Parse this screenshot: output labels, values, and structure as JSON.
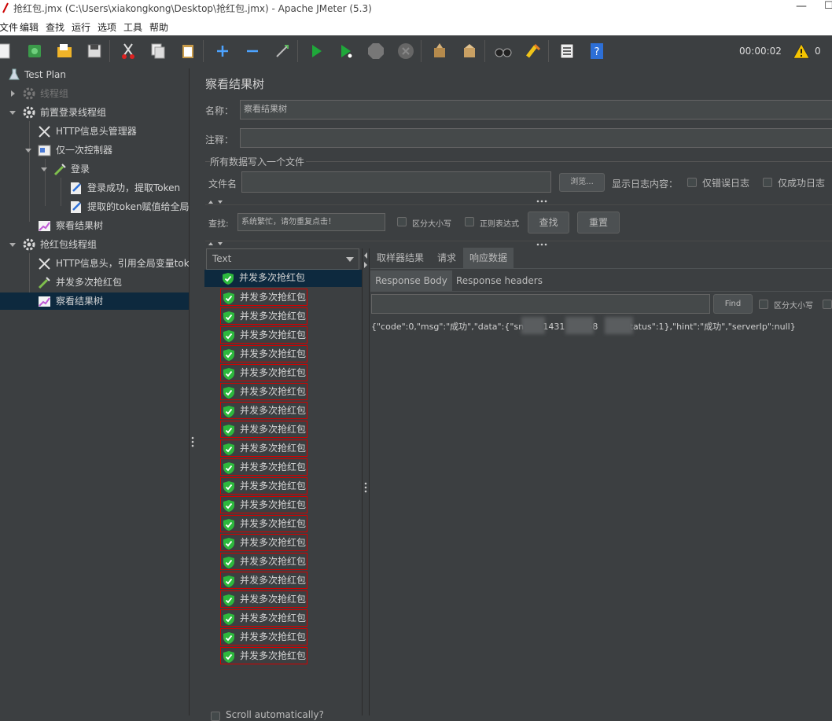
{
  "window": {
    "title": "抢红包.jmx (C:\\Users\\xiakongkong\\Desktop\\抢红包.jmx) - Apache JMeter (5.3)",
    "minimize": "—",
    "maximize": "☐"
  },
  "menu": [
    "文件",
    "编辑",
    "查找",
    "运行",
    "选项",
    "工具",
    "帮助"
  ],
  "toolbar": {
    "icons": [
      "new-icon",
      "templates-icon",
      "open-icon",
      "save-icon",
      "cut-icon",
      "copy-icon",
      "paste-icon",
      "expand-icon",
      "collapse-icon",
      "toggle-icon",
      "start-icon",
      "start-no-pause-icon",
      "stop-icon",
      "shutdown-icon",
      "clear-icon",
      "clear-all-icon",
      "search-icon",
      "reset-search-icon",
      "function-helper-icon",
      "help-icon"
    ],
    "timer": "00:00:02",
    "warning_count": "0"
  },
  "tree": {
    "test_plan": "Test Plan",
    "thread_group": "线程组",
    "login_group": "前置登录线程组",
    "http_header_manager": "HTTP信息头管理器",
    "once_controller": "仅一次控制器",
    "login": "登录",
    "extract_token": "登录成功，提取Token",
    "token_global": "提取的token赋值给全局变",
    "view_results_1": "察看结果树",
    "grab_group": "抢红包线程组",
    "http_header_global": "HTTP信息头，引用全局变量token",
    "concurrent_grab": "并发多次抢红包",
    "view_results_2": "察看结果树"
  },
  "panel": {
    "title": "察看结果树",
    "name_label": "名称：",
    "name_value": "察看结果树",
    "comment_label": "注释：",
    "comment_value": "",
    "file_section": "所有数据写入一个文件",
    "filename_label": "文件名",
    "filename_value": "",
    "browse": "浏览...",
    "log_label": "显示日志内容：",
    "errors_only": "仅错误日志",
    "success_only": "仅成功日志",
    "search_label": "查找:",
    "search_value": "系统繁忙，请勿重复点击！",
    "case_sensitive": "区分大小写",
    "regex": "正则表达式",
    "find_btn": "查找",
    "reset_btn": "重置"
  },
  "renderer": {
    "selected": "Text"
  },
  "results": {
    "items": [
      "并发多次抢红包",
      "并发多次抢红包",
      "并发多次抢红包",
      "并发多次抢红包",
      "并发多次抢红包",
      "并发多次抢红包",
      "并发多次抢红包",
      "并发多次抢红包",
      "并发多次抢红包",
      "并发多次抢红包",
      "并发多次抢红包",
      "并发多次抢红包",
      "并发多次抢红包",
      "并发多次抢红包",
      "并发多次抢红包",
      "并发多次抢红包",
      "并发多次抢红包",
      "并发多次抢红包",
      "并发多次抢红包",
      "并发多次抢红包",
      "并发多次抢红包"
    ],
    "scroll_auto": "Scroll automatically?"
  },
  "detail": {
    "tabs": [
      "取样器结果",
      "请求",
      "响应数据"
    ],
    "subtabs": [
      "Response Body",
      "Response headers"
    ],
    "find_btn": "Find",
    "case_sensitive": "区分大小写",
    "response_text": "{\"code\":0,\"msg\":\"成功\",\"data\":{\"sn\":\"   1431        58      \",\"status\":1},\"hint\":\"成功\",\"serverIp\":null}"
  },
  "colors": {
    "background": "#3c3f41",
    "field": "#45494a",
    "selection": "#0d293e",
    "highlight_border": "#d40000",
    "success_shield": "#2db83d"
  }
}
